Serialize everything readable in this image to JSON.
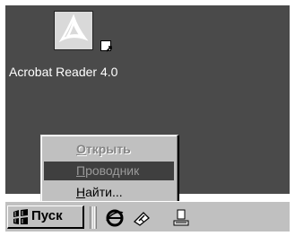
{
  "desktop": {
    "icons": [
      {
        "label": "Acrobat Reader 4.0",
        "icon": "acrobat-reader-icon"
      }
    ]
  },
  "context_menu": {
    "items": [
      {
        "label": "Открыть",
        "state": "disabled"
      },
      {
        "label": "Проводник",
        "state": "highlighted"
      },
      {
        "label": "Найти...",
        "state": "normal"
      }
    ]
  },
  "taskbar": {
    "start_label": "Пуск",
    "quick_launch": [
      "internet-explorer-icon",
      "show-desktop-icon",
      "channels-icon"
    ]
  },
  "colors": {
    "desktop_bg": "#4a4a4a",
    "menu_bg": "#c0c0c0",
    "highlight_bg": "#3f3f3f"
  }
}
